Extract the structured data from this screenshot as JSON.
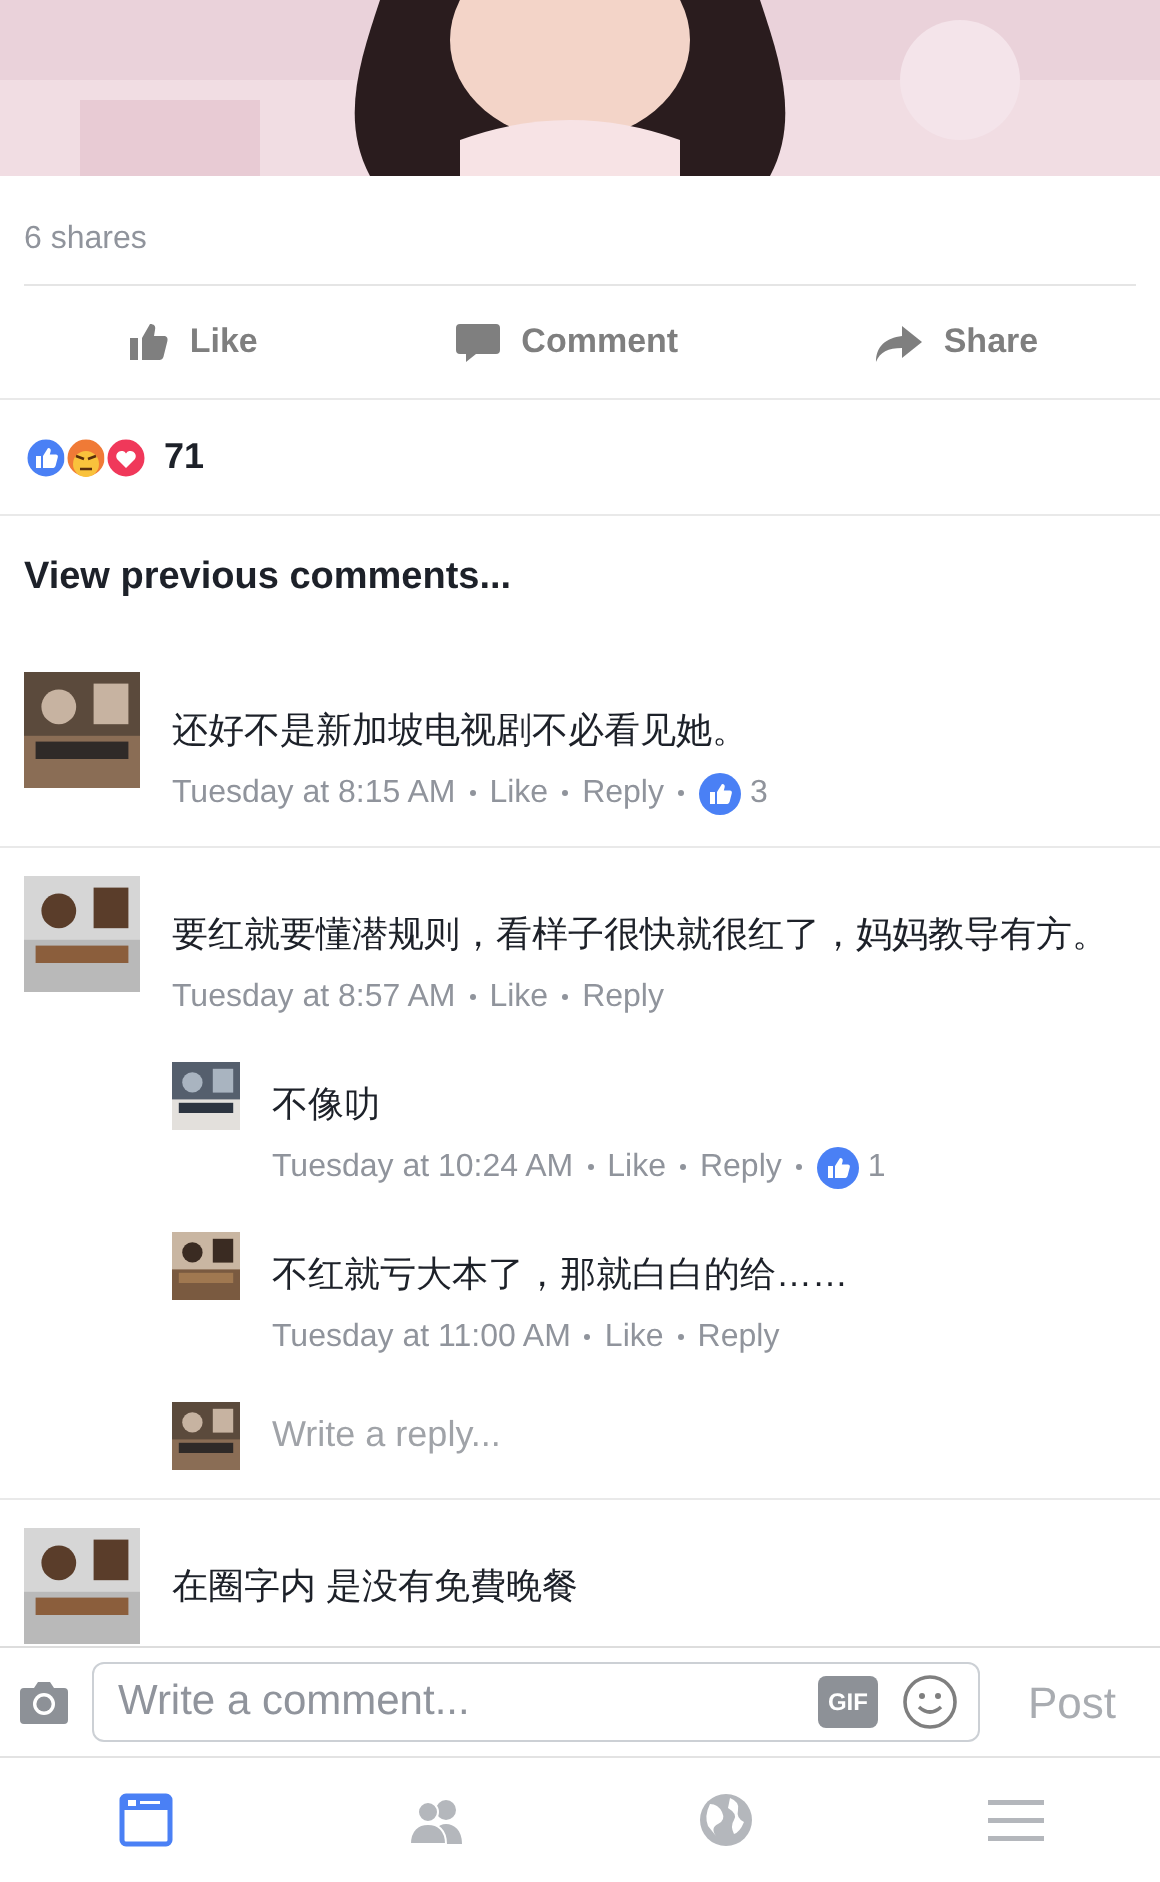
{
  "post": {
    "shares": "6 shares",
    "actions": [
      {
        "kind": "like",
        "label": "Like"
      },
      {
        "kind": "comment",
        "label": "Comment"
      },
      {
        "kind": "share",
        "label": "Share"
      }
    ],
    "reactions": {
      "icons": [
        {
          "kind": "like"
        },
        {
          "kind": "angry"
        },
        {
          "kind": "love"
        }
      ],
      "count": "71"
    },
    "view_previous": "View previous comments..."
  },
  "comments": [
    {
      "text": "还好不是新加坡电视剧不必看见她。",
      "time": "Tuesday at 8:15 AM",
      "like": "Like",
      "reply": "Reply",
      "likes": "3"
    },
    {
      "text": "要红就要懂潜规则，看样子很快就很红了，妈妈教导有方。",
      "time": "Tuesday at 8:57 AM",
      "like": "Like",
      "reply": "Reply",
      "replies": [
        {
          "text": "不像叻",
          "time": "Tuesday at 10:24 AM",
          "like": "Like",
          "reply": "Reply",
          "likes": "1"
        },
        {
          "text": "不红就亏大本了，那就白白的给……",
          "time": "Tuesday at 11:00 AM",
          "like": "Like",
          "reply": "Reply"
        }
      ],
      "reply_field": {
        "placeholder": "Write a reply..."
      }
    },
    {
      "text": "在圈字内 是没有免費晚餐"
    }
  ],
  "composer": {
    "placeholder": "Write a comment...",
    "gif": "GIF",
    "post": "Post",
    "post_disabled": true
  },
  "tab_bar": [
    {
      "kind": "feed",
      "selected": true
    },
    {
      "kind": "friends",
      "selected": false
    },
    {
      "kind": "globe",
      "selected": false
    },
    {
      "kind": "menu",
      "selected": false
    }
  ]
}
